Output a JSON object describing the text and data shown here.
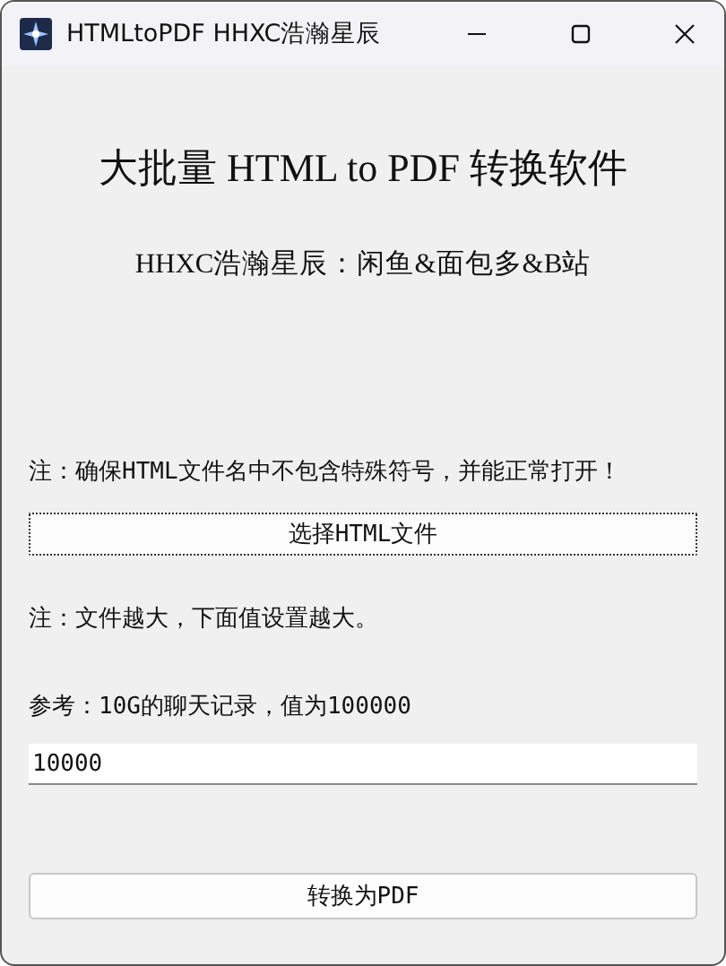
{
  "window": {
    "title": "HTMLtoPDF HHXC浩瀚星辰"
  },
  "heading": "大批量 HTML to PDF 转换软件",
  "subtitle": "HHXC浩瀚星辰：闲鱼&面包多&B站",
  "note_1": "注：确保HTML文件名中不包含特殊符号，并能正常打开！",
  "select_button": {
    "label": "选择HTML文件",
    "focused": true
  },
  "note_2": "注：文件越大，下面值设置越大。",
  "note_3": "参考：10G的聊天记录，值为100000",
  "value_field": {
    "value": "10000"
  },
  "convert_button": {
    "label": "转换为PDF",
    "focused": false
  }
}
